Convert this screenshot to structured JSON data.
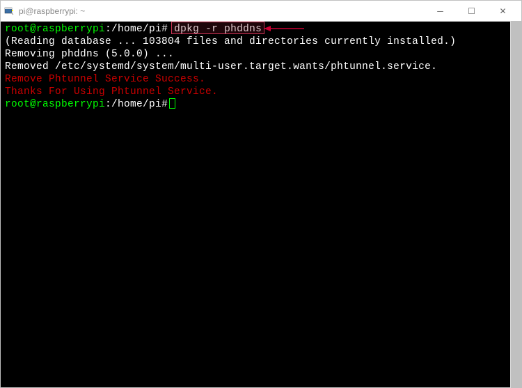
{
  "window": {
    "title": "pi@raspberrypi: ~"
  },
  "controls": {
    "minimize": "─",
    "maximize": "☐",
    "close": "✕"
  },
  "terminal": {
    "prompt1": {
      "user_host": "root@raspberrypi",
      "colon": ":",
      "path": "/home/pi",
      "hash": "#",
      "command": "dpkg -r phddns"
    },
    "line_db": "(Reading database ... 103804 files and directories currently installed.)",
    "line_rm": "Removing phddns (5.0.0) ...",
    "line_rm2": "Removed /etc/systemd/system/multi-user.target.wants/phtunnel.service.",
    "line_success": "Remove Phtunnel Service Success.",
    "line_thanks": "Thanks For Using Phtunnel Service.",
    "prompt2": {
      "user_host": "root@raspberrypi",
      "colon": ":",
      "path": "/home/pi",
      "hash": "#"
    }
  },
  "annotation": {
    "highlight_name": "command-highlight",
    "arrow_name": "arrow-annotation"
  }
}
